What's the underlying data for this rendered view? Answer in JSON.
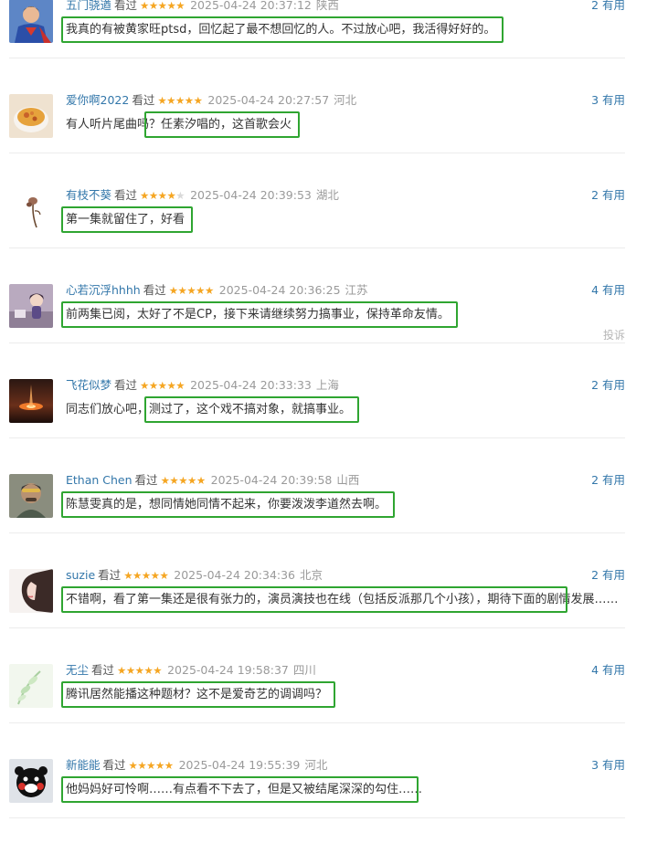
{
  "comments": [
    {
      "user": "五门骁遒",
      "status": "看过",
      "rating": 5,
      "time": "2025-04-24 20:37:12",
      "location": "陕西",
      "votes": "2 有用",
      "text": "我真的有被黄家旺ptsd，回忆起了最不想回忆的人。不过放心吧，我活得好好的。",
      "avatar": "superman-avatar"
    },
    {
      "user": "爱你啊2022",
      "status": "看过",
      "rating": 5,
      "time": "2025-04-24 20:27:57",
      "location": "河北",
      "votes": "3 有用",
      "text": "有人听片尾曲吗？任素汐唱的，这首歌会火",
      "avatar": "soup-bowl-avatar"
    },
    {
      "user": "有枝不葵",
      "status": "看过",
      "rating": 4,
      "time": "2025-04-24 20:39:53",
      "location": "湖北",
      "votes": "2 有用",
      "text": "第一集就留住了，好看",
      "avatar": "flower-branch-avatar"
    },
    {
      "user": "心若沉浮hhhh",
      "status": "看过",
      "rating": 5,
      "time": "2025-04-24 20:36:25",
      "location": "江苏",
      "votes": "4 有用",
      "text": "前两集已阅，太好了不是CP，接下来请继续努力搞事业，保持革命友情。",
      "avatar": "cartoon-girl-avatar",
      "report": "投诉"
    },
    {
      "user": "飞花似梦",
      "status": "看过",
      "rating": 5,
      "time": "2025-04-24 20:33:33",
      "location": "上海",
      "votes": "2 有用",
      "text": "同志们放心吧，测过了，这个戏不搞对象，就搞事业。",
      "avatar": "sunset-avatar"
    },
    {
      "user": "Ethan Chen",
      "status": "看过",
      "rating": 5,
      "time": "2025-04-24 20:39:58",
      "location": "山西",
      "votes": "2 有用",
      "text": "陈慧雯真的是，想同情她同情不起来，你要泼泼李道然去啊。",
      "avatar": "man-portrait-avatar"
    },
    {
      "user": "suzie",
      "status": "看过",
      "rating": 5,
      "time": "2025-04-24 20:34:36",
      "location": "北京",
      "votes": "2 有用",
      "text": "不错啊，看了第一集还是很有张力的，演员演技也在线（包括反派那几个小孩），期待下面的剧情发展……",
      "avatar": "woman-profile-avatar"
    },
    {
      "user": "无尘",
      "status": "看过",
      "rating": 5,
      "time": "2025-04-24 19:58:37",
      "location": "四川",
      "votes": "4 有用",
      "text": "腾讯居然能播这种题材？这不是爱奇艺的调调吗？",
      "avatar": "watercolor-plant-avatar"
    },
    {
      "user": "新能能",
      "status": "看过",
      "rating": 5,
      "time": "2025-04-24 19:55:39",
      "location": "河北",
      "votes": "3 有用",
      "text": "他妈妈好可怜啊……有点看不下去了，但是又被结尾深深的勾住……",
      "avatar": "kumamon-avatar"
    }
  ],
  "highlights": [
    {
      "from": 0,
      "to": 39
    },
    {
      "from": 7,
      "to": 20
    },
    {
      "from": 0,
      "to": 10
    },
    {
      "from": 0,
      "to": 33
    },
    {
      "from": 7,
      "to": 25
    },
    {
      "from": 0,
      "to": 28
    },
    {
      "from": 0,
      "to": 42
    },
    {
      "from": 0,
      "to": 22
    },
    {
      "from": 0,
      "to": 29
    }
  ],
  "colors": {
    "username": "#3377aa",
    "star": "#f5a623",
    "star_empty": "#d9d9d9",
    "highlight_box": "#2fa531",
    "meta": "#9a9a9a",
    "text": "#333333"
  }
}
